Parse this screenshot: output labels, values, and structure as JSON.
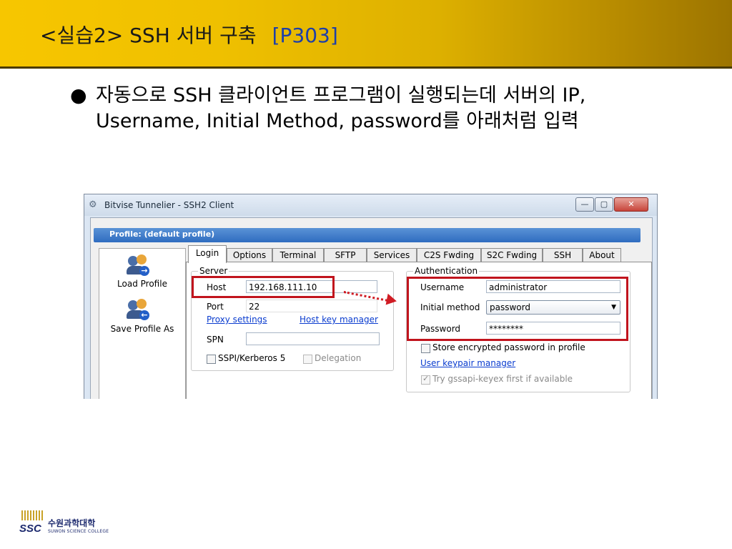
{
  "slide": {
    "title": "<실습2> SSH 서버 구축",
    "page_ref": "[P303]",
    "bullet": "자동으로 SSH 클라이언트 프로그램이 실행되는데 서버의 IP, Username, Initial Method, password를 아래처럼 입력"
  },
  "window": {
    "title": "Bitvise Tunnelier - SSH2 Client",
    "buttons": {
      "minimize": "—",
      "maximize": "▢",
      "close": "✕"
    },
    "profile_label": "Profile:  (default profile)",
    "side": {
      "load_profile": "Load Profile",
      "save_profile": "Save Profile As"
    },
    "tabs": [
      "Login",
      "Options",
      "Terminal",
      "SFTP",
      "Services",
      "C2S Fwding",
      "S2C Fwding",
      "SSH",
      "About"
    ],
    "server": {
      "group_label": "Server",
      "host_label": "Host",
      "host_value": "192.168.111.10",
      "port_label": "Port",
      "port_value": "22",
      "proxy_link": "Proxy settings",
      "hostkey_link": "Host key manager",
      "spn_label": "SPN",
      "spn_value": "",
      "sspi_label": "SSPI/Kerberos 5",
      "delegation_label": "Delegation"
    },
    "auth": {
      "group_label": "Authentication",
      "username_label": "Username",
      "username_value": "administrator",
      "method_label": "Initial method",
      "method_value": "password",
      "password_label": "Password",
      "password_value": "********",
      "store_label": "Store encrypted password in profile",
      "keypair_link": "User keypair manager",
      "gssapi_label": "Try gssapi-keyex first if available"
    }
  },
  "logo": {
    "korean": "수원과학대학",
    "english": "SUWON SCIENCE COLLEGE",
    "mark": "SSC"
  },
  "colors": {
    "header_gold": "#f7c600",
    "title_blue": "#1d3fa8",
    "highlight_red": "#c1141d"
  }
}
